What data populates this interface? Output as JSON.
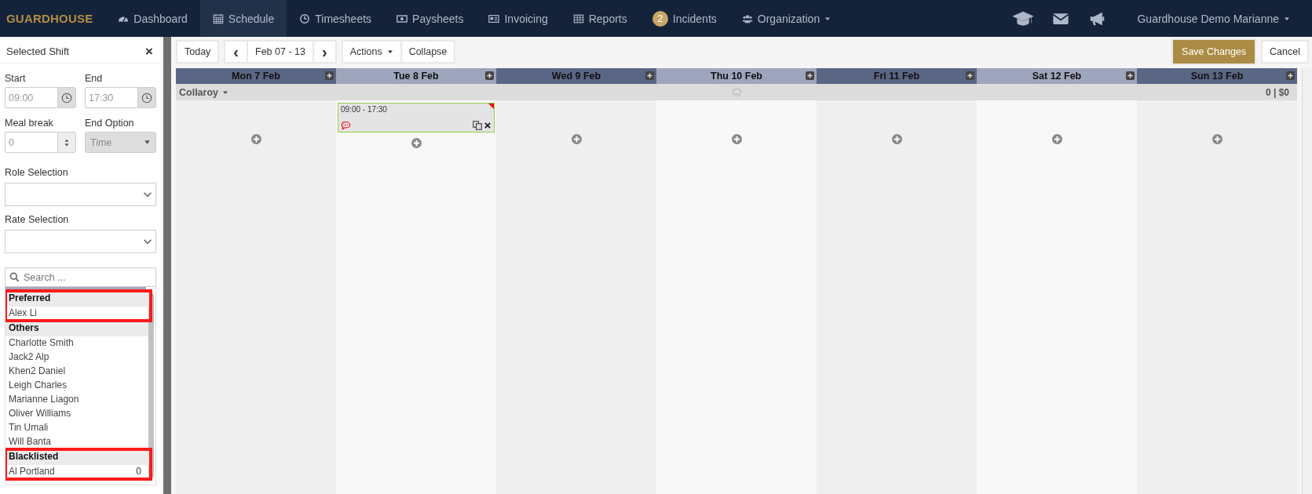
{
  "navbar": {
    "logo": "GUARDHOUSE",
    "items": [
      {
        "label": "Dashboard",
        "selected": false
      },
      {
        "label": "Schedule",
        "selected": true
      },
      {
        "label": "Timesheets",
        "selected": false
      },
      {
        "label": "Paysheets",
        "selected": false
      },
      {
        "label": "Invoicing",
        "selected": false
      },
      {
        "label": "Reports",
        "selected": false
      },
      {
        "label": "Incidents",
        "badge": "2",
        "selected": false
      },
      {
        "label": "Organization",
        "dropdown": true,
        "selected": false
      }
    ],
    "user": "Guardhouse Demo Marianne"
  },
  "sidebar": {
    "title": "Selected Shift",
    "close": "×",
    "start": {
      "label": "Start",
      "value": "09:00"
    },
    "end": {
      "label": "End",
      "value": "17:30"
    },
    "meal_break": {
      "label": "Meal break",
      "value": "0"
    },
    "end_option": {
      "label": "End Option",
      "value": "Time",
      "disabled": true
    },
    "role_selection": {
      "label": "Role Selection"
    },
    "rate_selection": {
      "label": "Rate Selection"
    },
    "search": {
      "placeholder": "Search ..."
    },
    "groups": [
      {
        "title": "Preferred",
        "highlighted": true,
        "staff": [
          {
            "name": "Alex Li"
          }
        ]
      },
      {
        "title": "Others",
        "highlighted": false,
        "staff": [
          {
            "name": "Charlotte Smith"
          },
          {
            "name": "Jack2 Alp"
          },
          {
            "name": "Khen2 Daniel"
          },
          {
            "name": "Leigh Charles"
          },
          {
            "name": "Marianne Liagon"
          },
          {
            "name": "Oliver Williams"
          },
          {
            "name": "Tin Umali"
          },
          {
            "name": "Will Banta"
          }
        ]
      },
      {
        "title": "Blacklisted",
        "highlighted": true,
        "staff": [
          {
            "name": "Al Portland",
            "count": "0"
          }
        ]
      }
    ]
  },
  "toolbar": {
    "today": "Today",
    "prev": "‹",
    "range": "Feb 07 - 13",
    "next": "›",
    "actions": "Actions",
    "collapse": "Collapse",
    "save": "Save Changes",
    "cancel": "Cancel"
  },
  "schedule": {
    "days": [
      {
        "label": "Mon 7 Feb",
        "marker": false
      },
      {
        "label": "Tue 8 Feb",
        "marker": false,
        "shifts": [
          {
            "time": "09:00 - 17:30",
            "comment": true,
            "flagged": true
          }
        ]
      },
      {
        "label": "Wed 9 Feb",
        "marker": false
      },
      {
        "label": "Thu 10 Feb",
        "marker": true
      },
      {
        "label": "Fri 11 Feb",
        "marker": false
      },
      {
        "label": "Sat 12 Feb",
        "marker": false
      },
      {
        "label": "Sun 13 Feb",
        "marker": false
      }
    ],
    "location": {
      "name": "Collaroy",
      "total": "0 | $0"
    }
  }
}
